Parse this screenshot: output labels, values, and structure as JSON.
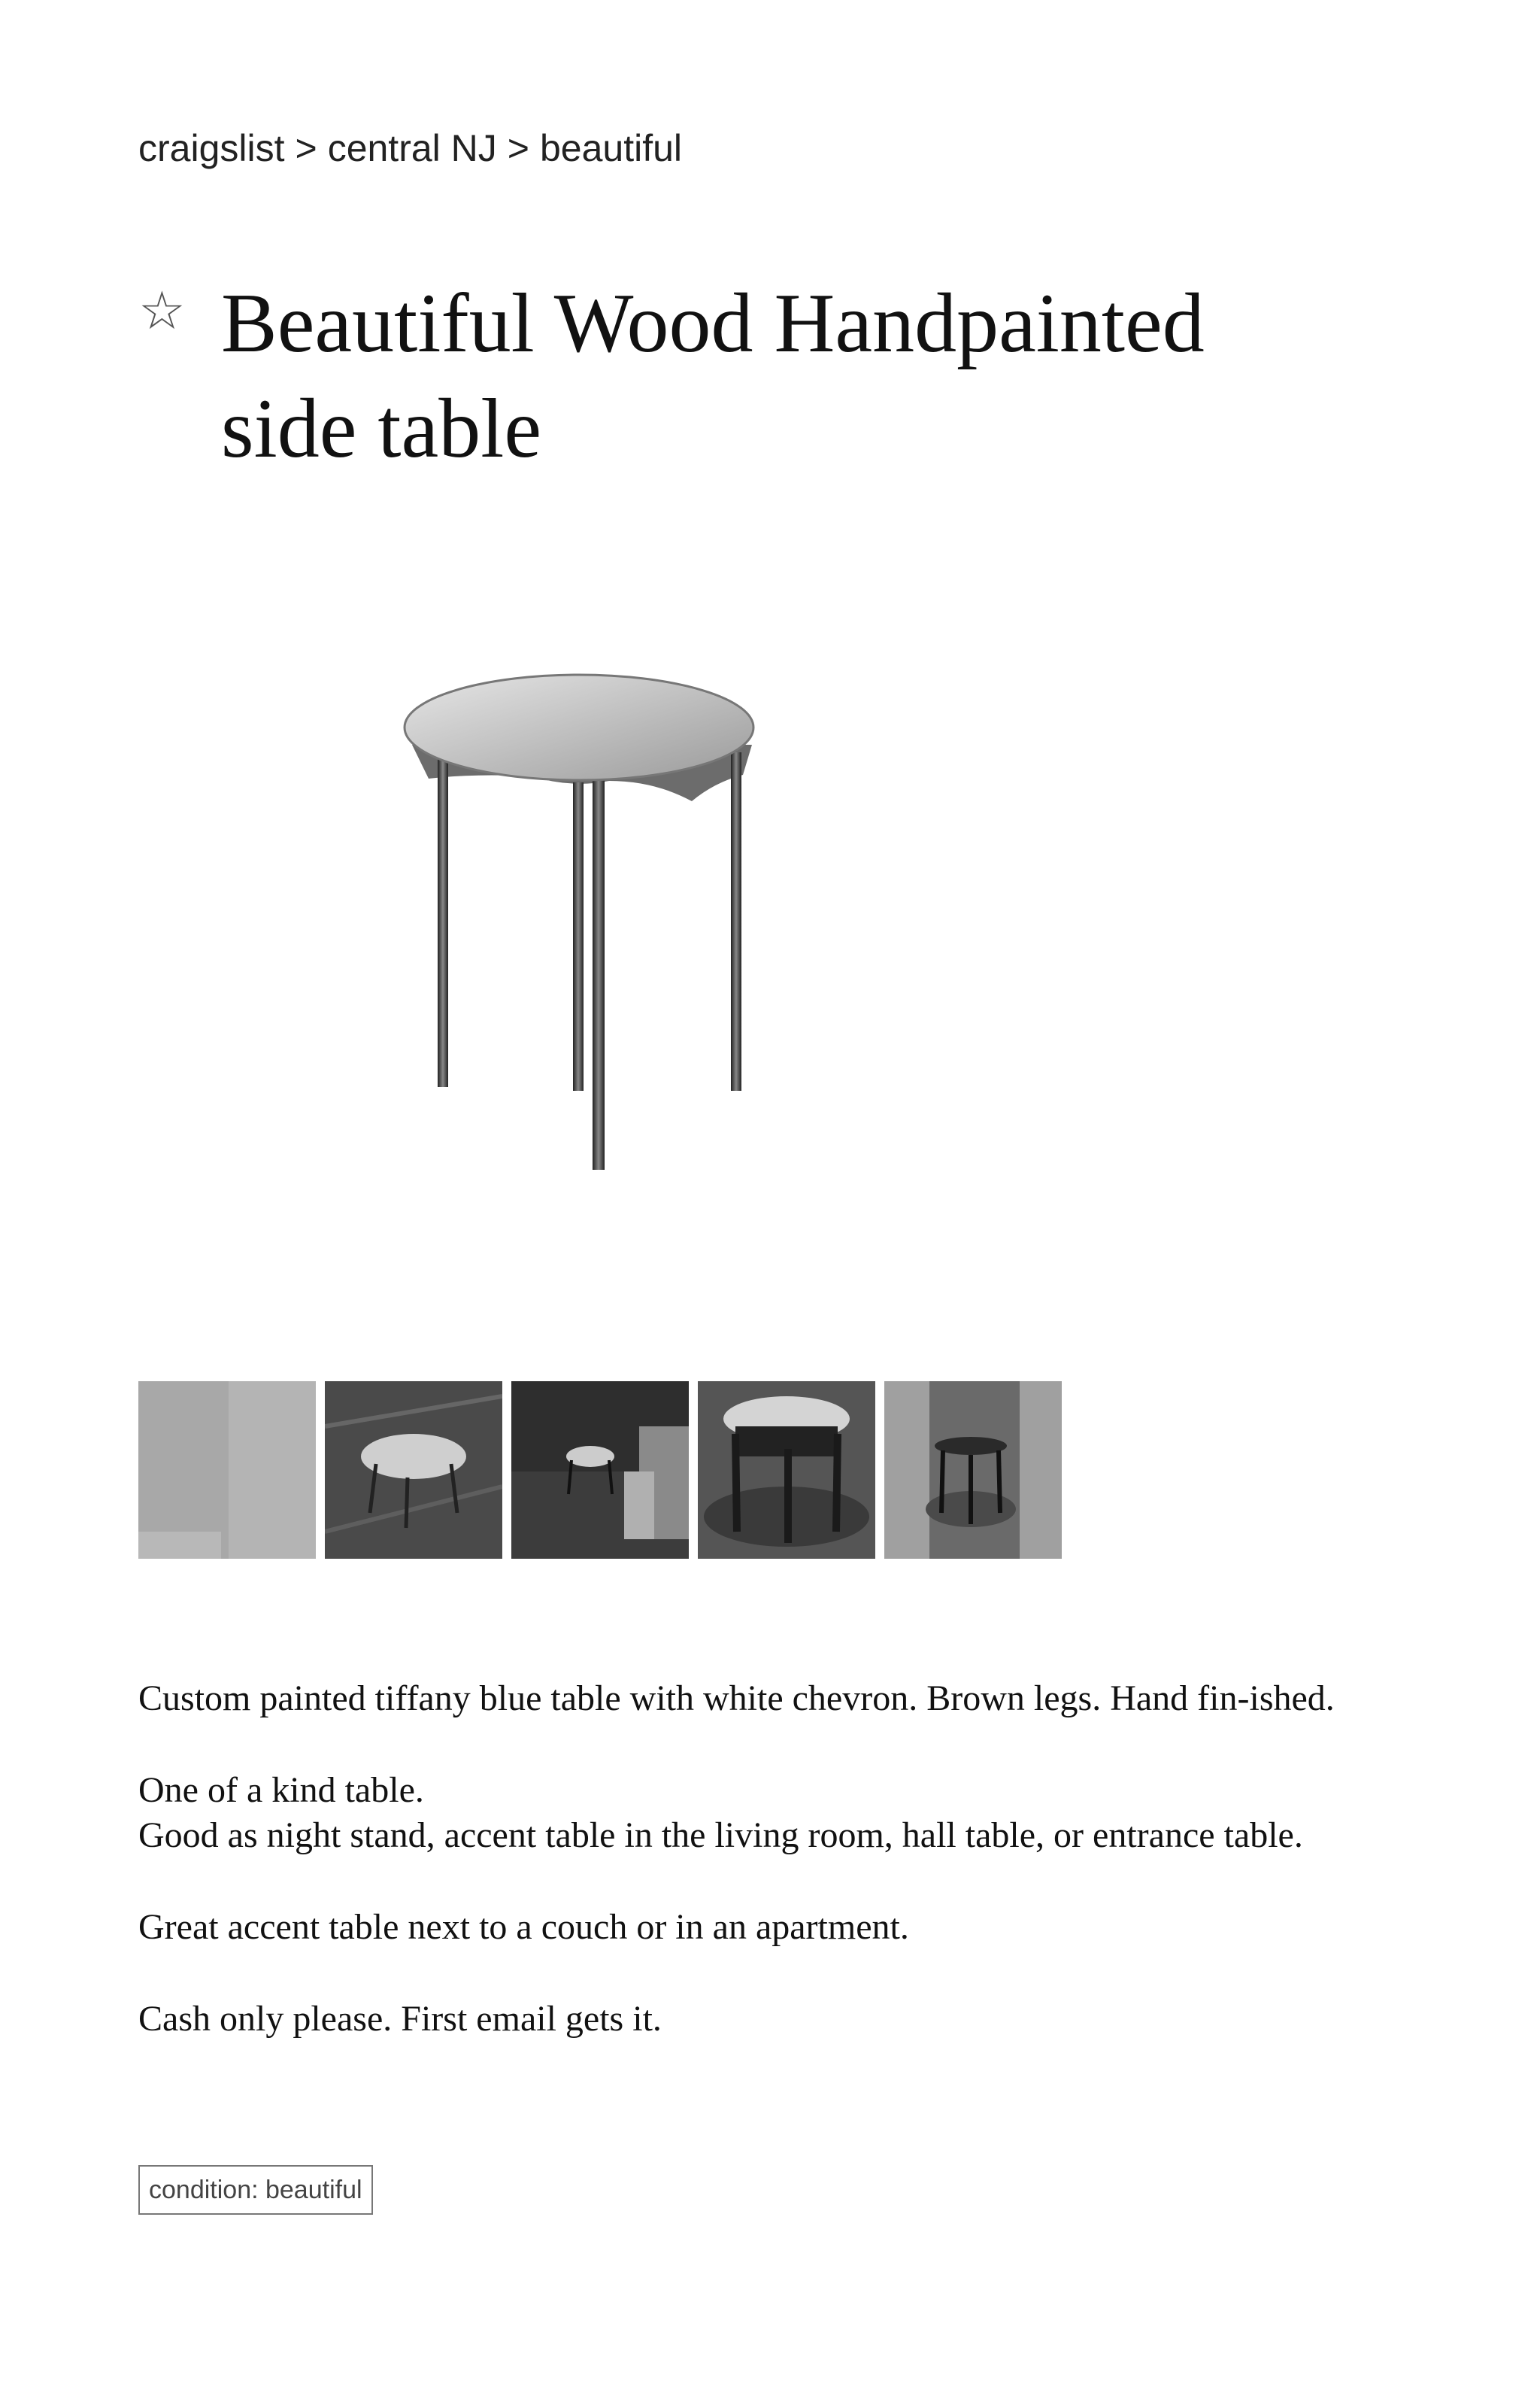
{
  "breadcrumb": {
    "site": "craigslist",
    "separator": ">",
    "area": "central NJ",
    "category": "beautiful"
  },
  "posting": {
    "star_icon": "star-outline-icon",
    "title": "Beautiful Wood Handpainted side table"
  },
  "gallery": {
    "main_image_icon": "side-table-photo",
    "thumbnails": [
      {
        "icon": "teal-swatch-thumbnail"
      },
      {
        "icon": "table-on-wood-floor-thumbnail"
      },
      {
        "icon": "table-in-room-thumbnail"
      },
      {
        "icon": "table-closeup-thumbnail"
      },
      {
        "icon": "table-against-wall-thumbnail"
      }
    ]
  },
  "description": {
    "p1": "Custom painted tiffany blue table with white chevron. Brown legs. Hand fin-ished.",
    "p2a": "One of a kind table.",
    "p2b": "Good as night stand, accent table in the living room, hall table, or entrance table.",
    "p3": "Great accent table next to a couch or in an apartment.",
    "p4": "Cash only please. First email gets it."
  },
  "attributes": {
    "condition": "condition: beautiful"
  }
}
